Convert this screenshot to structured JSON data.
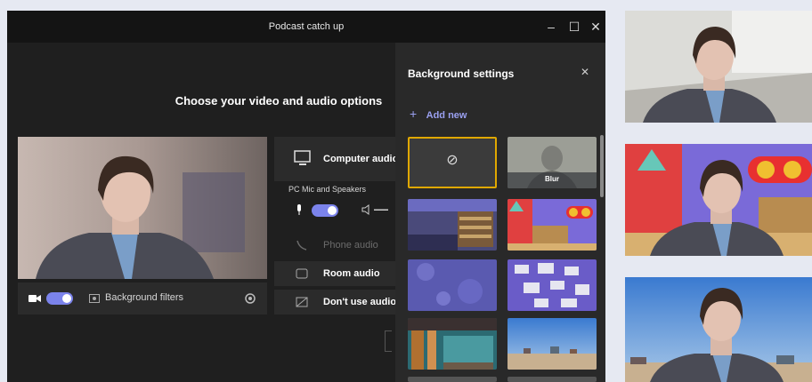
{
  "window": {
    "title": "Podcast catch up",
    "minimize_glyph": "–",
    "maximize_glyph": "☐",
    "close_glyph": "✕"
  },
  "prejoin": {
    "heading": "Choose your video and audio options",
    "background_filters_label": "Background filters",
    "video_toggle": "on",
    "audio": {
      "computer_audio_label": "Computer audio",
      "device_label": "PC Mic and Speakers",
      "mic_toggle": "on",
      "phone_audio_label": "Phone audio",
      "room_audio_label": "Room audio",
      "dont_use_audio_label": "Don't use audio"
    }
  },
  "background_settings": {
    "title": "Background settings",
    "close_glyph": "✕",
    "add_new_label": "Add new",
    "add_glyph": "+",
    "selected": "none",
    "blur_label": "Blur",
    "none_glyph": "⊘"
  },
  "colors": {
    "accent": "#7b83eb",
    "selected_border": "#e0a800",
    "panel_bg": "#292929",
    "window_bg": "#1f1f1f"
  }
}
